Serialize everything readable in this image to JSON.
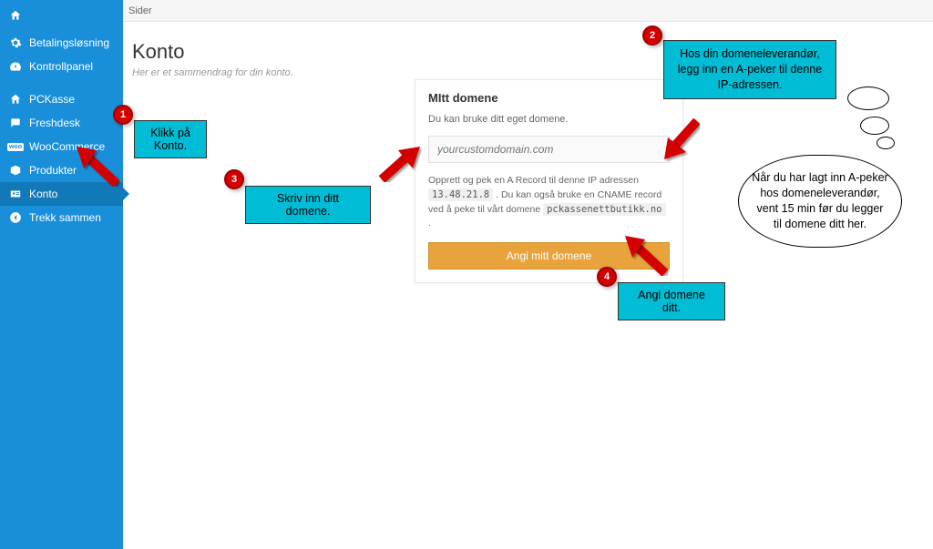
{
  "topbar": {
    "label": "Sider"
  },
  "sidebar": {
    "items": [
      {
        "label": ""
      },
      {
        "label": "Betalingsløsning"
      },
      {
        "label": "Kontrollpanel"
      },
      {
        "label": "PCKasse"
      },
      {
        "label": "Freshdesk"
      },
      {
        "label": "WooCommerce"
      },
      {
        "label": "Produkter"
      },
      {
        "label": "Konto"
      },
      {
        "label": "Trekk sammen"
      }
    ]
  },
  "page": {
    "title": "Konto",
    "subtitle": "Her er et sammendrag for din konto."
  },
  "panel": {
    "title": "MItt domene",
    "desc": "Du kan bruke ditt eget domene.",
    "placeholder": "yourcustomdomain.com",
    "hint_1a": "Opprett og pek en A Record til denne IP adressen ",
    "hint_ip": "13.48.21.8",
    "hint_1b": " . Du kan også bruke en CNAME record ved å peke til vårt domene ",
    "hint_cname": "pckassenettbutikk.no",
    "hint_1c": " .",
    "button": "Angi mitt domene"
  },
  "callouts": {
    "n1": "1",
    "c1": "Klikk på Konto.",
    "n2": "2",
    "c2": "Hos din domeneleverandør, legg inn en A-peker til denne IP-adressen.",
    "n3": "3",
    "c3": "Skriv inn ditt domene.",
    "n4": "4",
    "c4": "Angi domene ditt.",
    "thought": "Når du har lagt inn A-peker hos domeneleverandør, vent 15 min før du legger til domene ditt her."
  }
}
